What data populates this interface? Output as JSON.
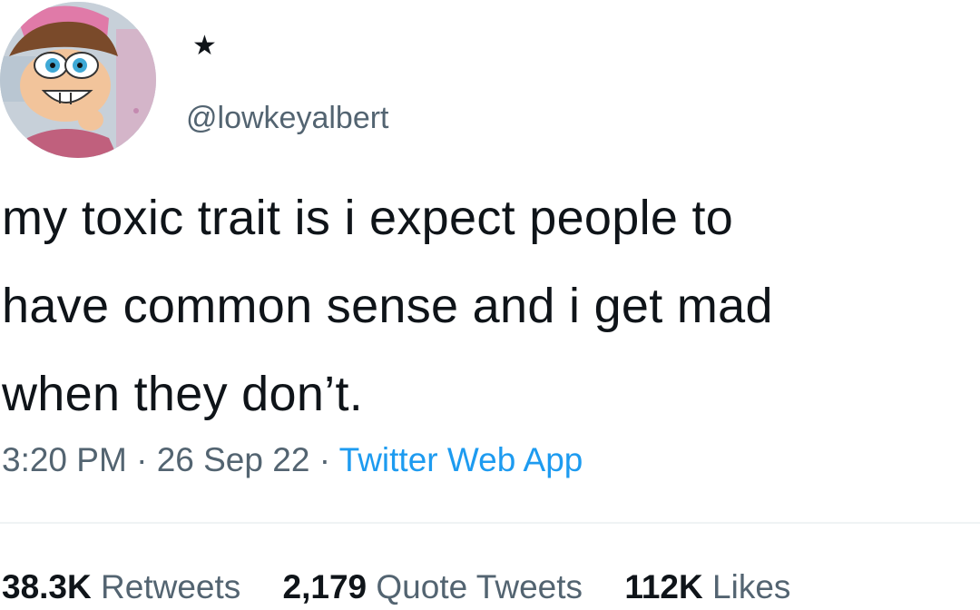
{
  "tweet": {
    "display_name": "★",
    "handle": "@lowkeyalbert",
    "text_lines": [
      "my toxic trait is i expect people to",
      "have common sense and i get mad",
      "when they don’t."
    ],
    "time": "3:20 PM",
    "date": "26 Sep 22",
    "separator": "·",
    "source": "Twitter Web App",
    "stats": [
      {
        "count": "38.3K",
        "label": "Retweets"
      },
      {
        "count": "2,179",
        "label": "Quote Tweets"
      },
      {
        "count": "112K",
        "label": "Likes"
      }
    ]
  },
  "colors": {
    "text": "#0f1419",
    "secondary": "#536471",
    "link": "#1d9bf0",
    "divider": "#eff3f4"
  },
  "icons": {
    "avatar": "cartoon-character-avatar"
  }
}
